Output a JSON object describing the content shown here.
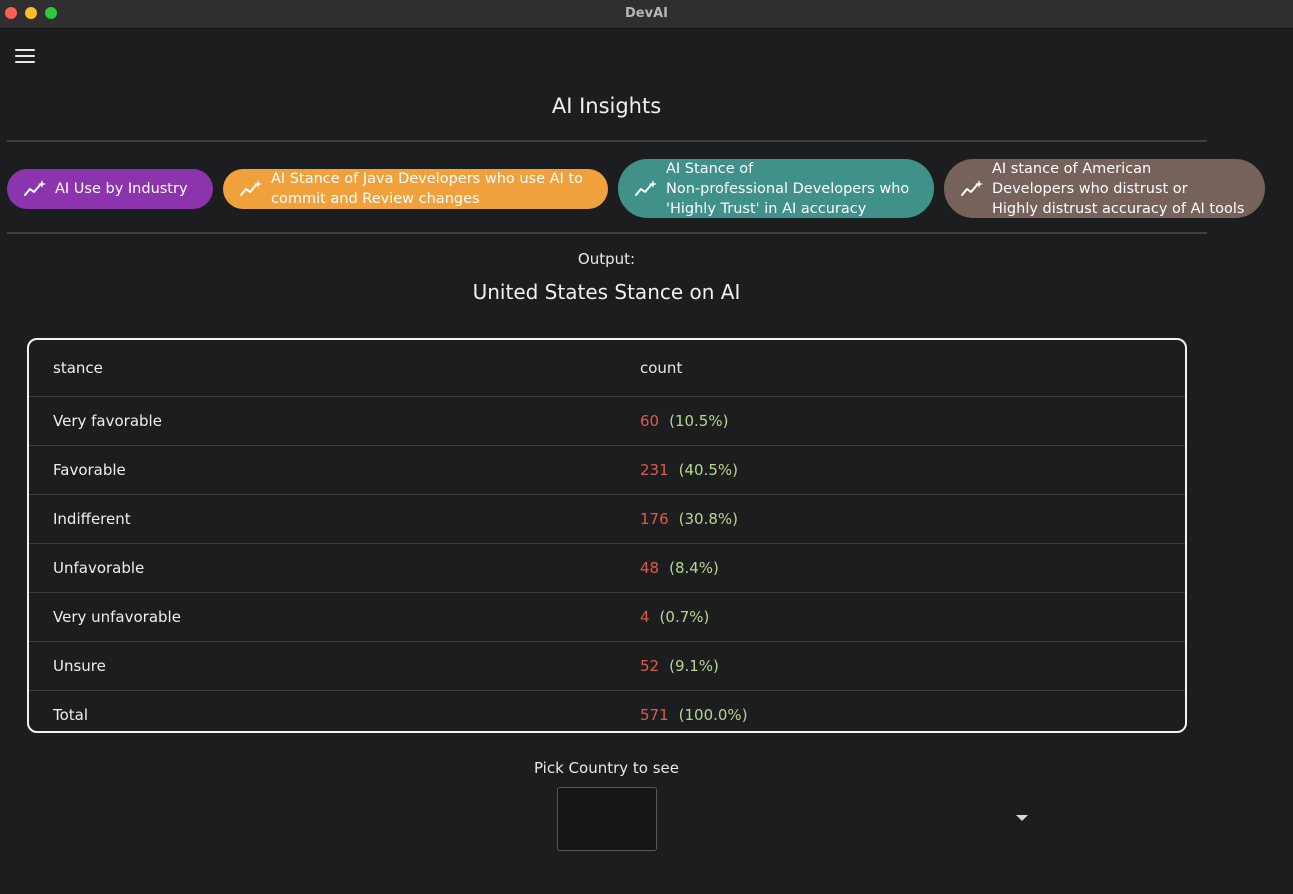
{
  "window": {
    "title": "DevAI"
  },
  "page": {
    "title": "AI Insights"
  },
  "pills": [
    {
      "label": "AI Use by Industry",
      "icon": "sparkle-chart-icon",
      "color": "#8c33ae"
    },
    {
      "label": "AI Stance of Java Developers who use AI to\n  commit and Review changes",
      "icon": "sparkle-chart-icon",
      "color": "#f0a13b"
    },
    {
      "label": "AI Stance of\nNon-professional Developers who\n'Highly Trust' in AI accuracy",
      "icon": "sparkle-chart-icon",
      "color": "#3f918a"
    },
    {
      "label": "AI stance of American\n Developers who distrust or\nHighly distrust accuracy of AI tools",
      "icon": "sparkle-chart-icon",
      "color": "#77615b"
    }
  ],
  "output": {
    "label": "Output:",
    "title": "United States Stance on AI"
  },
  "table": {
    "headers": [
      "stance",
      "count"
    ],
    "rows": [
      {
        "stance": "Very favorable",
        "count": "60",
        "pct": "(10.5%)"
      },
      {
        "stance": "Favorable",
        "count": "231",
        "pct": "(40.5%)"
      },
      {
        "stance": "Indifferent",
        "count": "176",
        "pct": "(30.8%)"
      },
      {
        "stance": "Unfavorable",
        "count": "48",
        "pct": "(8.4%)"
      },
      {
        "stance": "Very unfavorable",
        "count": "4",
        "pct": "(0.7%)"
      },
      {
        "stance": "Unsure",
        "count": "52",
        "pct": "(9.1%)"
      },
      {
        "stance": "Total",
        "count": "571",
        "pct": "(100.0%)"
      }
    ]
  },
  "country_picker": {
    "label": "Pick Country to see",
    "value": ""
  },
  "colors": {
    "background": "#1c1d1f",
    "count": "#e2584c",
    "percent": "#b5d88f"
  }
}
